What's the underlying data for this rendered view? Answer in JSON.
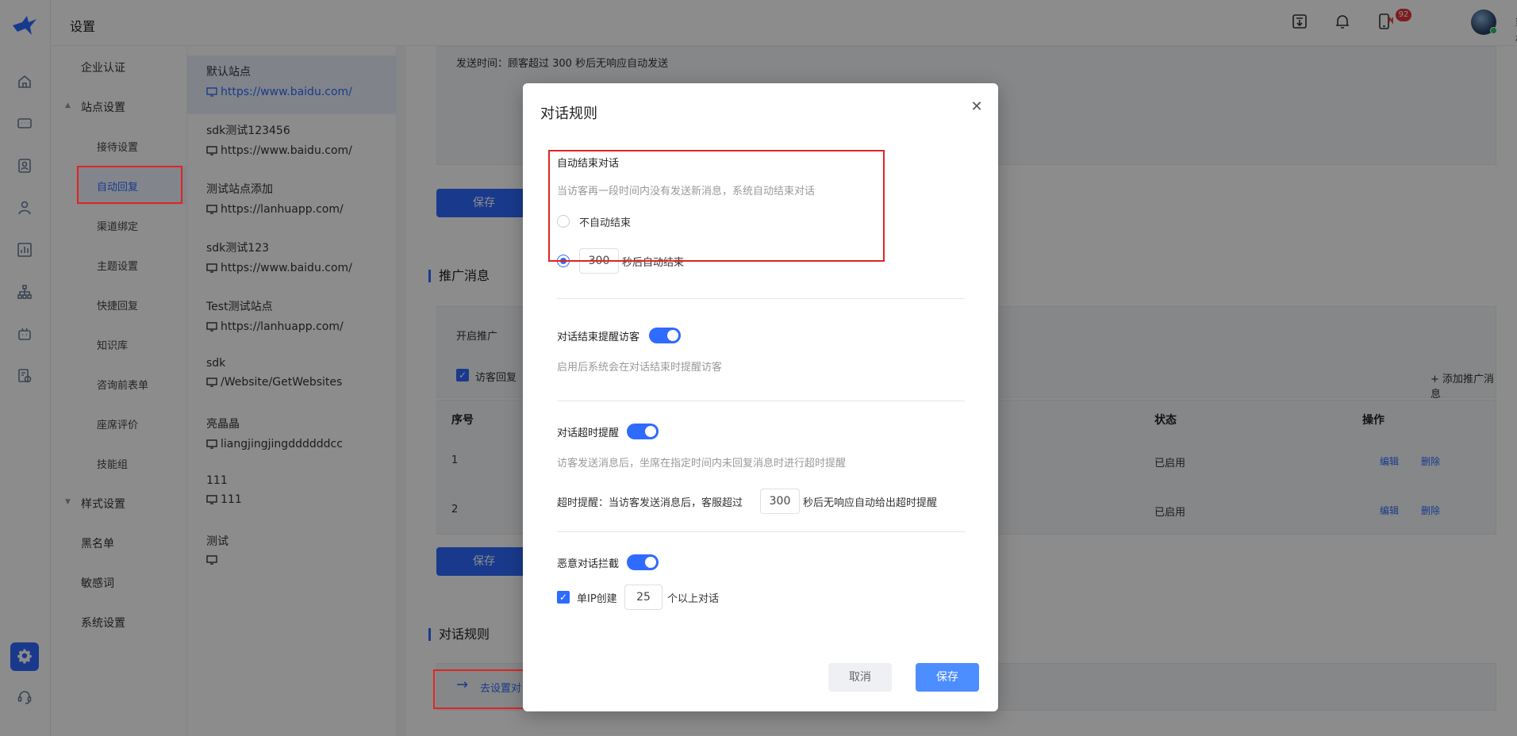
{
  "header": {
    "title": "设置",
    "notification_count": "92",
    "user_name": "郭栋"
  },
  "subnav": {
    "items": [
      {
        "label": "企业认证"
      },
      {
        "label": "站点设置"
      },
      {
        "label": "接待设置"
      },
      {
        "label": "自动回复"
      },
      {
        "label": "渠道绑定"
      },
      {
        "label": "主题设置"
      },
      {
        "label": "快捷回复"
      },
      {
        "label": "知识库"
      },
      {
        "label": "咨询前表单"
      },
      {
        "label": "座席评价"
      },
      {
        "label": "技能组"
      },
      {
        "label": "样式设置"
      },
      {
        "label": "黑名单"
      },
      {
        "label": "敏感词"
      },
      {
        "label": "系统设置"
      }
    ]
  },
  "sites": [
    {
      "name": "默认站点",
      "url": "https://www.baidu.com/"
    },
    {
      "name": "sdk测试123456",
      "url": "https://www.baidu.com/"
    },
    {
      "name": "测试站点添加",
      "url": "https://lanhuapp.com/"
    },
    {
      "name": "sdk测试123",
      "url": "https://www.baidu.com/"
    },
    {
      "name": "Test测试站点",
      "url": "https://lanhuapp.com/"
    },
    {
      "name": "sdk",
      "url": "/Website/GetWebsites"
    },
    {
      "name": "亮晶晶",
      "url": "liangjingjingddddddcc"
    },
    {
      "name": "111",
      "url": "111"
    },
    {
      "name": "测试",
      "url": ""
    }
  ],
  "main": {
    "send_time_text": "发送时间：顾客超过 300 秒后无响应自动发送",
    "save_label": "保存",
    "promo_title": "推广消息",
    "enable_promo_label": "开启推广",
    "visitor_reply_label": "访客回复",
    "add_promo_label": "+ 添加推广消息",
    "table": {
      "headers": {
        "index": "序号",
        "status": "状态",
        "action": "操作"
      },
      "rows": [
        {
          "index": "1",
          "status": "已启用",
          "edit": "编辑",
          "delete": "删除"
        },
        {
          "index": "2",
          "status": "已启用",
          "edit": "编辑",
          "delete": "删除"
        }
      ]
    },
    "rules_title": "对话规则",
    "goto_rules_label": "去设置对"
  },
  "modal": {
    "title": "对话规则",
    "auto_end": {
      "label": "自动结束对话",
      "hint": "当访客再一段时间内没有发送新消息，系统自动结束对话",
      "option_none": "不自动结束",
      "seconds": "300",
      "option_seconds_suffix": "秒后自动结束"
    },
    "end_notify": {
      "label": "对话结束提醒访客",
      "hint": "启用后系统会在对话结束时提醒访客"
    },
    "timeout": {
      "label": "对话超时提醒",
      "hint": "访客发送消息后，坐席在指定时间内未回复消息时进行超时提醒",
      "prefix": "超时提醒：当访客发送消息后，客服超过",
      "seconds": "300",
      "suffix": "秒后无响应自动给出超时提醒"
    },
    "malicious": {
      "label": "恶意对话拦截",
      "ip_prefix": "单IP创建",
      "count": "25",
      "ip_suffix": "个以上对话"
    },
    "cancel_label": "取消",
    "save_label": "保存"
  },
  "colors": {
    "accent": "#2f6bff",
    "highlight_box": "#e02424",
    "badge": "#e5333a"
  }
}
